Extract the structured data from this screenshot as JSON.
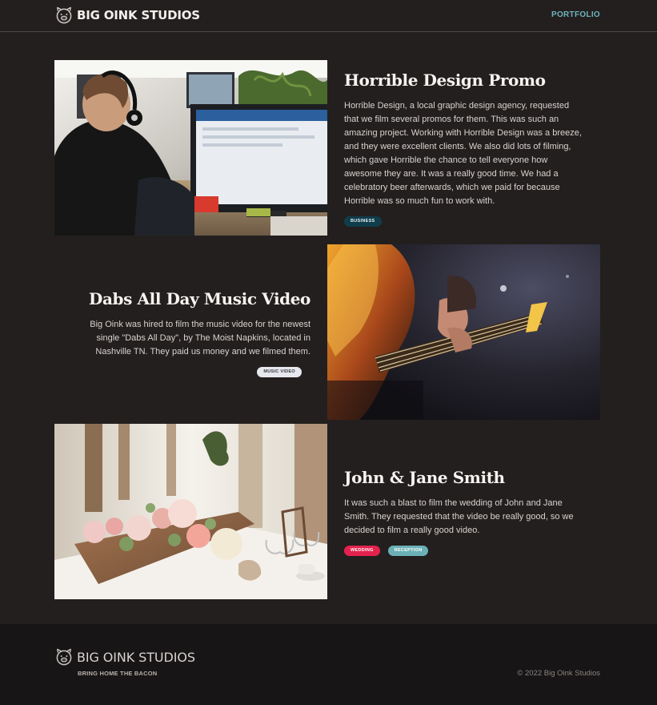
{
  "header": {
    "brand": "BIG OINK STUDIOS",
    "logo_icon": "pig-icon",
    "nav": [
      {
        "label": "PORTFOLIO"
      }
    ]
  },
  "projects": [
    {
      "title": "Horrible Design Promo",
      "description": "Horrible Design, a local graphic design agency, requested that we film several promos for them. This was such an amazing project. Working with Horrible Design was a breeze, and they were excellent clients. We also did lots of filming, which gave Horrible the chance to tell everyone how awesome they are. It was a really good time. We had a celebratory beer afterwards, which we paid for because Horrible was so much fun to work with.",
      "image": "person-at-computer-with-headphones",
      "tags": [
        {
          "label": "BUSINESS",
          "bg": "#0f3d4b",
          "fg": "#e8f2f4"
        }
      ]
    },
    {
      "title": "Dabs All Day Music Video",
      "description": "Big Oink was hired to film the music video for the newest single \"Dabs All Day\", by The Moist Napkins, located in Nashville TN. They paid us money and we filmed them.",
      "image": "bass-guitar-closeup",
      "tags": [
        {
          "label": "MUSIC VIDEO",
          "bg": "#e6e8ee",
          "fg": "#3a3a44"
        }
      ]
    },
    {
      "title": "John & Jane Smith",
      "description": "It was such a blast to film the wedding of John and Jane Smith. They requested that the video be really good, so we decided to film a really good video.",
      "image": "wedding-table-flowers",
      "tags": [
        {
          "label": "WEDDING",
          "bg": "#e3224e",
          "fg": "#ffffff"
        },
        {
          "label": "RECEPTION",
          "bg": "#6bb0b6",
          "fg": "#ffffff"
        }
      ]
    }
  ],
  "footer": {
    "brand": "BIG OINK STUDIOS",
    "tagline": "BRING HOME THE BACON",
    "copyright": "© 2022 Big Oink Studios"
  }
}
